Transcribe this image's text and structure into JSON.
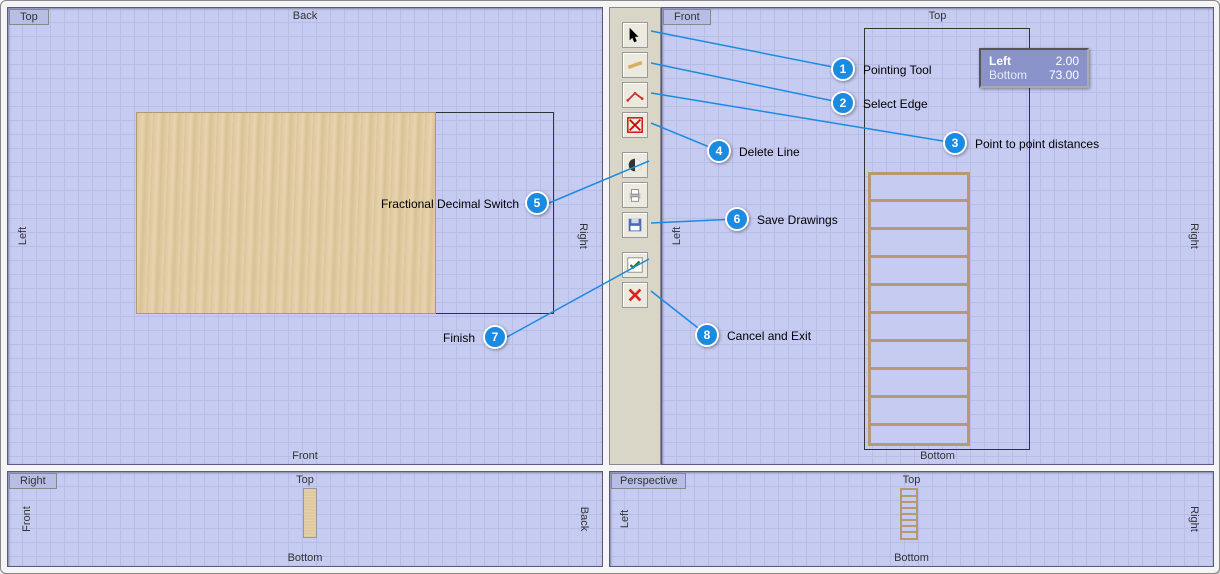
{
  "viewports": {
    "tl": {
      "title": "Top",
      "top": "Back",
      "bottom": "Front",
      "left": "Left",
      "right": "Right"
    },
    "tr": {
      "title": "Front",
      "top": "Top",
      "bottom": "Bottom",
      "left": "Left",
      "right": "Right"
    },
    "bl": {
      "title": "Right",
      "top": "Top",
      "bottom": "Bottom",
      "left": "Front",
      "right": "Back"
    },
    "br": {
      "title": "Perspective",
      "top": "Top",
      "bottom": "Bottom",
      "left": "Left",
      "right": "Right"
    }
  },
  "info_box": {
    "rows": [
      {
        "key": "Left",
        "value": "2.00"
      },
      {
        "key": "Bottom",
        "value": "73.00"
      }
    ]
  },
  "toolbar": [
    {
      "id": "pointer",
      "label": "Pointing Tool"
    },
    {
      "id": "select-edge",
      "label": "Select Edge"
    },
    {
      "id": "distance",
      "label": "Point to point distances"
    },
    {
      "id": "delete-line",
      "label": "Delete Line"
    },
    {
      "id": "frac-dec-switch",
      "label": "Fractional Decimal Switch"
    },
    {
      "id": "print",
      "label": "Print"
    },
    {
      "id": "save",
      "label": "Save Drawings"
    },
    {
      "id": "finish",
      "label": "Finish"
    },
    {
      "id": "cancel",
      "label": "Cancel and Exit"
    }
  ],
  "callouts": {
    "1": "Pointing Tool",
    "2": "Select Edge",
    "3": "Point to point distances",
    "4": "Delete Line",
    "5": "Fractional Decimal Switch",
    "6": "Save Drawings",
    "7": "Finish",
    "8": "Cancel and Exit"
  }
}
